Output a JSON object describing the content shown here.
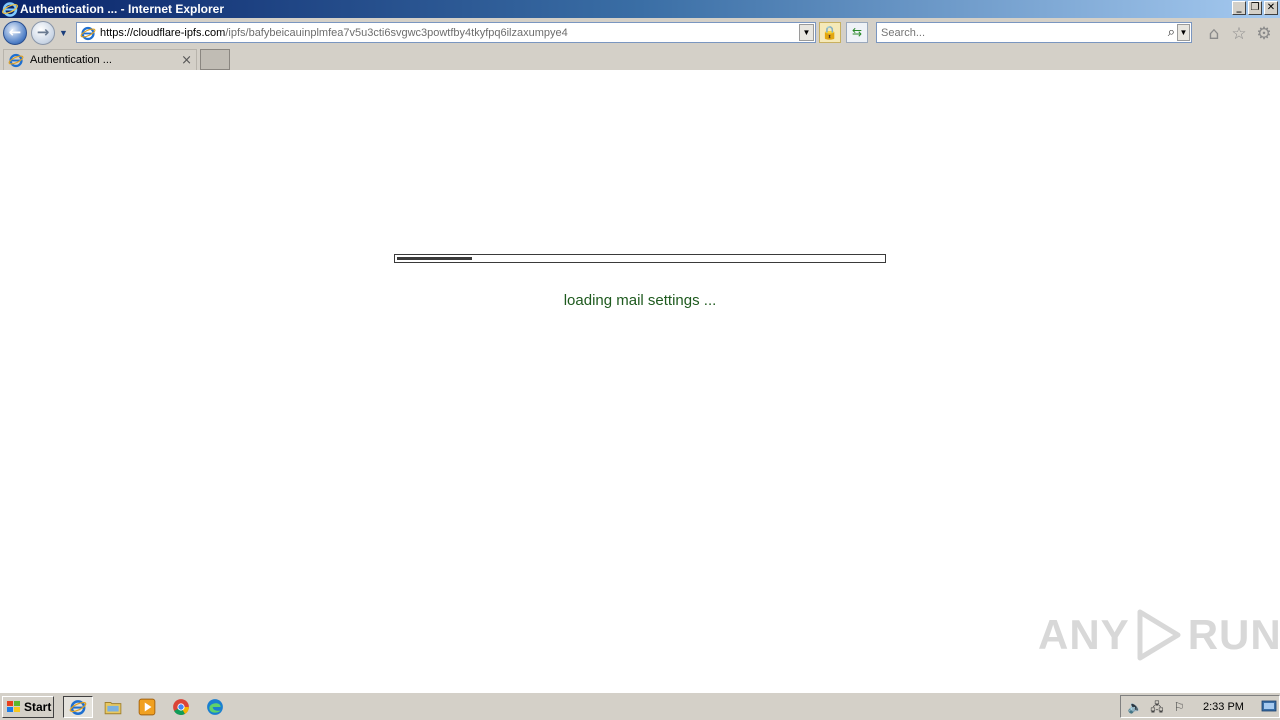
{
  "window": {
    "title": "Authentication ... - Internet Explorer",
    "controls": {
      "minimize": "_",
      "restore": "❐",
      "close": "✕"
    }
  },
  "navbar": {
    "back_icon": "back-arrow-icon",
    "forward_icon": "forward-arrow-icon",
    "address": {
      "url_host": "https://cloudflare-ipfs.com",
      "url_path": "/ipfs/bafybeicauinplmfea7v5u3cti6svgwc3powtfby4tkyfpq6ilzaxumpye4"
    },
    "search": {
      "placeholder": "Search..."
    }
  },
  "tabs": [
    {
      "label": "Authentication ...",
      "close": "×"
    }
  ],
  "page": {
    "progress_fraction": 0.155,
    "loading_text": "loading mail settings ...",
    "watermark": {
      "left": "ANY",
      "right": "RUN"
    }
  },
  "taskbar": {
    "start_label": "Start",
    "apps": [
      "internet-explorer",
      "file-explorer",
      "media-player",
      "chrome",
      "edge"
    ],
    "clock": "2:33 PM"
  },
  "colors": {
    "loading_text": "#1e5a1e",
    "titlebar_start": "#0a246a",
    "chrome": "#d4d0c8"
  }
}
